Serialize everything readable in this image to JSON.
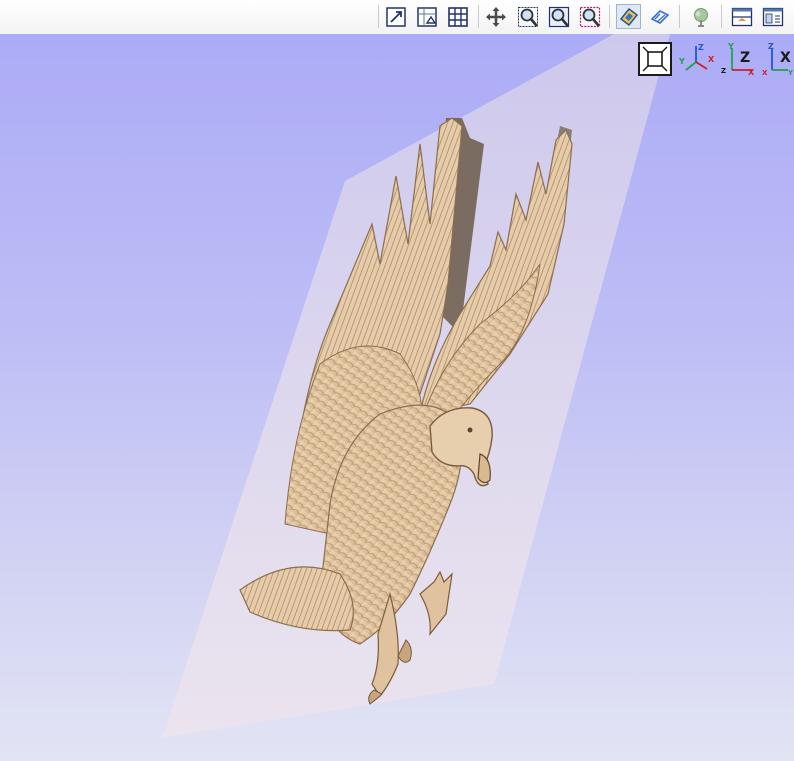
{
  "toolbar": {
    "buttons": [
      {
        "name": "zoom-to-fit-icon",
        "pressed": false
      },
      {
        "name": "scale-view-icon",
        "pressed": false
      },
      {
        "name": "grid-icon",
        "pressed": false
      },
      {
        "name": "pan-icon",
        "pressed": false
      },
      {
        "name": "zoom-icon",
        "pressed": false
      },
      {
        "name": "zoom-box-icon",
        "pressed": false
      },
      {
        "name": "zoom-selection-icon",
        "pressed": false
      },
      {
        "name": "render-material-icon",
        "pressed": true
      },
      {
        "name": "toolpath-icon",
        "pressed": false
      },
      {
        "name": "model-tree-icon",
        "pressed": false
      },
      {
        "name": "split-view-icon",
        "pressed": false
      },
      {
        "name": "layout-view-icon",
        "pressed": false
      }
    ]
  },
  "view_orientation": {
    "fit_label": "fit-view-icon",
    "iso": {
      "up": "Z",
      "left": "Y",
      "right": "X"
    },
    "top": {
      "up": "Y",
      "left": "Z",
      "right": "X"
    },
    "front": {
      "up": "Z",
      "left": "X",
      "right": "Y"
    },
    "axis_letters": {
      "z_large": "Z",
      "x_large": "X",
      "y_small": "Y",
      "x_small": "X",
      "z_small": "Z"
    }
  },
  "colors": {
    "viewport_top": "#acabf6",
    "viewport_bottom": "#e2e4f4",
    "material": "#e3c8a6",
    "material_shadow": "#6b5a48",
    "axis_x": "#cc2222",
    "axis_y": "#22a34a",
    "axis_z": "#2255cc"
  }
}
